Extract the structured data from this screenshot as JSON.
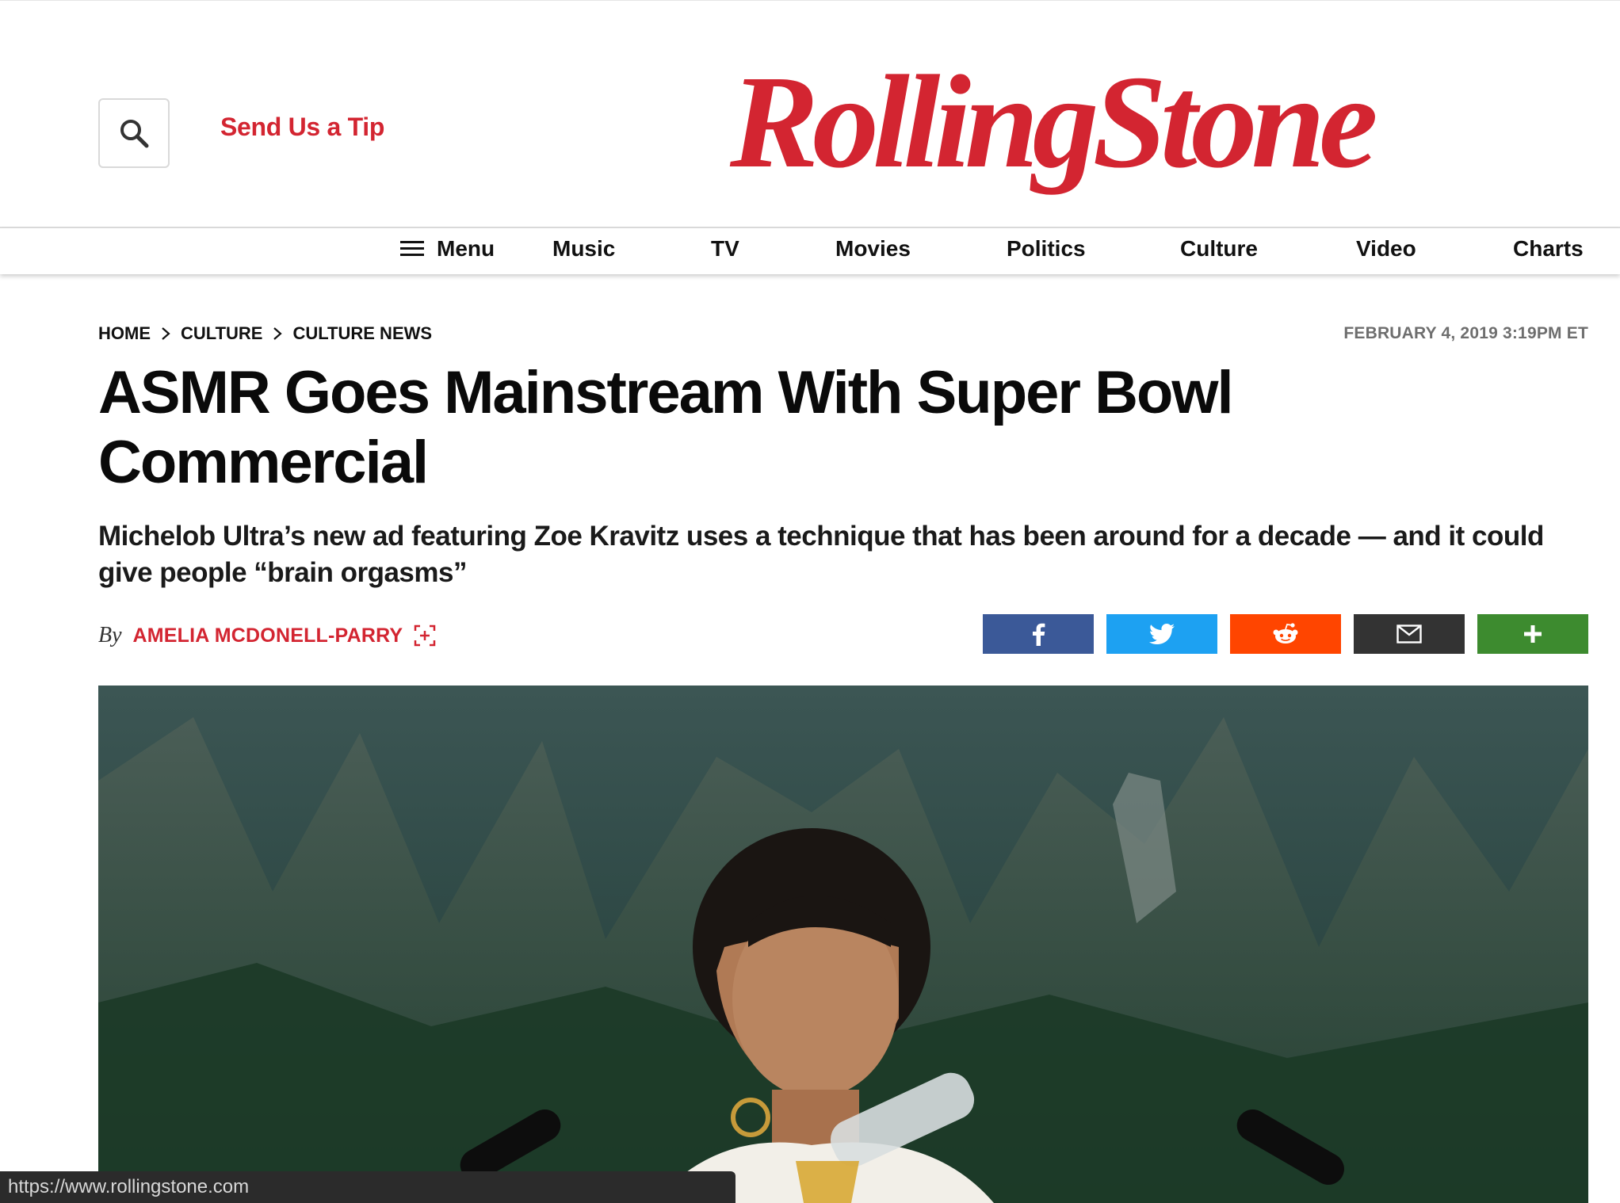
{
  "header": {
    "search_icon": "search-icon",
    "tip_label": "Send Us a Tip",
    "logo_text": "RollingStone",
    "brand_color": "#d32531"
  },
  "nav": {
    "menu_label": "Menu",
    "items": [
      "Music",
      "TV",
      "Movies",
      "Politics",
      "Culture",
      "Video",
      "Charts"
    ]
  },
  "article": {
    "breadcrumb": [
      "HOME",
      "CULTURE",
      "CULTURE NEWS"
    ],
    "date": "FEBRUARY 4, 2019 3:19PM ET",
    "headline": "ASMR Goes Mainstream With Super Bowl Commercial",
    "dek": "Michelob Ultra’s new ad featuring Zoe Kravitz uses a technique that has been around for a decade — and it could give people “brain orgasms”",
    "by_label": "By",
    "author": "AMELIA MCDONELL-PARRY"
  },
  "share_buttons": [
    {
      "icon": "facebook-icon",
      "color": "#3b5998"
    },
    {
      "icon": "twitter-icon",
      "color": "#1da1f2"
    },
    {
      "icon": "reddit-icon",
      "color": "#ff4500"
    },
    {
      "icon": "email-icon",
      "color": "#333333"
    },
    {
      "icon": "plus-icon",
      "color": "#3d8b2f"
    }
  ],
  "status_bar": {
    "url": "https://www.rollingstone.com"
  }
}
